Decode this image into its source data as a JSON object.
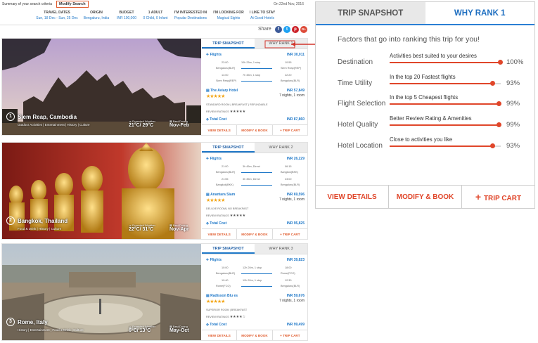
{
  "summary": {
    "label": "Summary of your search criteria",
    "modify": "Modify Search",
    "date_line": "On 22nd Nov, 2016",
    "criteria": [
      {
        "key": "TRAVEL DATES",
        "value": "Sun, 18 Dec - Sun, 25 Dec"
      },
      {
        "key": "ORIGIN",
        "value": "Bengaluru, India"
      },
      {
        "key": "BUDGET",
        "value": "INR 100,000"
      },
      {
        "key": "1 ADULT",
        "value": "0 Child, 0 Infant"
      },
      {
        "key": "I'M INTERESTED IN",
        "value": "Popular Destinations"
      },
      {
        "key": "I'M LOOKING FOR",
        "value": "Magical Sights"
      },
      {
        "key": "I LIKE TO STAY",
        "value": "At Good Hotels"
      }
    ]
  },
  "share": {
    "label": "Share",
    "icons": [
      "f",
      "t",
      "p",
      "G+"
    ]
  },
  "cards": [
    {
      "num": "1",
      "place": "Siem Reap, Cambodia",
      "tags": "Outdoor Activities | Entertainment | History | Culture",
      "weather_label": "Expected Weather",
      "weather": "21°C/ 29°C",
      "best_label": "Best During",
      "best": "Nov-Feb",
      "tab_snapshot": "TRIP SNAPSHOT",
      "tab_why": "WHY RANK 1",
      "flights_label": "Flights",
      "flights_price": "INR 30,011",
      "legs": [
        {
          "dep_time": "23:00",
          "dep_city": "Bengaluru(BLR)",
          "dur": "10h 25m, 1 stop",
          "arr_time": "10:55",
          "arr_city": "Siem Reap(REP)"
        },
        {
          "dep_time": "14:00",
          "dep_city": "Siem Reap(REP)",
          "dur": "7h 45m, 1 stop",
          "arr_time": "22:20",
          "arr_city": "Bengaluru(BLR)"
        }
      ],
      "hotel_name": "The Aviary Hotel",
      "hotel_price": "INR 57,849",
      "nights": "7 nights, 1 room",
      "room": "STANDARD ROOM | BREAKFAST | REFUNDABLE",
      "review_label": "REVIEW RATINGS",
      "total_label": "Total Cost",
      "total": "INR 87,860",
      "btn_view": "VIEW DETAILS",
      "btn_modify": "MODIFY & BOOK",
      "btn_cart": "TRIP CART"
    },
    {
      "num": "2",
      "place": "Bangkok, Thailand",
      "tags": "Food & Drink | History | Culture",
      "weather_label": "Expected Weather",
      "weather": "22°C/ 31°C",
      "best_label": "Best During",
      "best": "Nov-Apr",
      "tab_snapshot": "TRIP SNAPSHOT",
      "tab_why": "WHY RANK 2",
      "flights_label": "Flights",
      "flights_price": "INR 26,229",
      "legs": [
        {
          "dep_time": "21:00",
          "dep_city": "Bengaluru(BLR)",
          "dur": "3h 45m, Direct",
          "arr_time": "06:15",
          "arr_city": "Bangkok(BKK)"
        },
        {
          "dep_time": "21:55",
          "dep_city": "Bangkok(BKK)",
          "dur": "3h 35m, Direct",
          "arr_time": "23:00",
          "arr_city": "Bengaluru(BLR)"
        }
      ],
      "hotel_name": "Anantara Siam",
      "hotel_price": "INR 69,596",
      "nights": "7 nights, 1 room",
      "room": "DELUXE ROOM | NO BREAKFAST",
      "review_label": "REVIEW RATINGS",
      "total_label": "Total Cost",
      "total": "INR 95,825",
      "btn_view": "VIEW DETAILS",
      "btn_modify": "MODIFY & BOOK",
      "btn_cart": "TRIP CART"
    },
    {
      "num": "3",
      "place": "Rome, Italy",
      "tags": "History | Entertainment | Food & Drink | Culture",
      "weather_label": "Expected Weather",
      "weather": "6°C/ 13°C",
      "best_label": "Best During",
      "best": "May-Oct",
      "tab_snapshot": "TRIP SNAPSHOT",
      "tab_why": "WHY RANK 3",
      "flights_label": "Flights",
      "flights_price": "INR 39,823",
      "legs": [
        {
          "dep_time": "10:00",
          "dep_city": "Bengaluru(BLR)",
          "dur": "12h 20m, 1 stop",
          "arr_time": "18:00",
          "arr_city": "Rome(FCO)"
        },
        {
          "dep_time": "19:40",
          "dep_city": "Rome(FCO)",
          "dur": "12h 20m, 1 stop",
          "arr_time": "12:30",
          "arr_city": "Bengaluru(BLR)"
        }
      ],
      "hotel_name": "Radisson Blu es",
      "hotel_price": "INR 59,676",
      "nights": "7 nights, 1 room",
      "room": "SUPERIOR ROOM | BREAKFAST",
      "review_label": "REVIEW RATINGS",
      "total_label": "Total Cost",
      "total": "INR 99,499",
      "btn_view": "VIEW DETAILS",
      "btn_modify": "MODIFY & BOOK",
      "btn_cart": "TRIP CART"
    }
  ],
  "rank_panel": {
    "tab_snapshot": "TRIP SNAPSHOT",
    "tab_why": "WHY RANK 1",
    "title": "Factors that go into ranking this trip for you!",
    "factors": [
      {
        "name": "Destination",
        "desc": "Activities best suited to your desires",
        "value": 1.0,
        "pct": "100%"
      },
      {
        "name": "Time Utility",
        "desc": "In the top 20 Fastest flights",
        "value": 0.93,
        "pct": "93%"
      },
      {
        "name": "Flight Selection",
        "desc": "In the top 5 Cheapest flights",
        "value": 0.99,
        "pct": "99%"
      },
      {
        "name": "Hotel Quality",
        "desc": "Better Review Rating & Amenities",
        "value": 0.99,
        "pct": "99%"
      },
      {
        "name": "Hotel Location",
        "desc": "Close to activities you like",
        "value": 0.93,
        "pct": "93%"
      }
    ],
    "btn_view": "VIEW DETAILS",
    "btn_modify": "MODIFY & BOOK",
    "btn_cart": "TRIP CART"
  },
  "colors": {
    "accent": "#e05a2b",
    "blue": "#1f78c8",
    "star": "#f3a514"
  }
}
